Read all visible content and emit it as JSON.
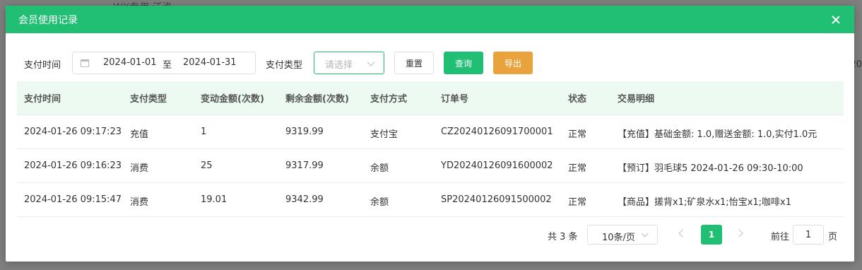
{
  "background": {
    "text": "WX专用  沃洛",
    "edge": "20"
  },
  "modal": {
    "title": "会员使用记录"
  },
  "filters": {
    "pay_time_label": "支付时间",
    "date_start": "2024-01-01",
    "date_sep": "至",
    "date_end": "2024-01-31",
    "pay_type_label": "支付类型",
    "pay_type_placeholder": "请选择",
    "reset_label": "重置",
    "query_label": "查询",
    "export_label": "导出"
  },
  "table": {
    "headers": [
      "支付时间",
      "支付类型",
      "变动金额(次数)",
      "剩余金额(次数)",
      "支付方式",
      "订单号",
      "状态",
      "交易明细"
    ],
    "rows": [
      [
        "2024-01-26 09:17:23",
        "充值",
        "1",
        "9319.99",
        "支付宝",
        "CZ20240126091700001",
        "正常",
        "【充值】基础金额: 1.0,赠送金额: 1.0,实付1.0元"
      ],
      [
        "2024-01-26 09:16:23",
        "消费",
        "25",
        "9317.99",
        "余额",
        "YD20240126091600002",
        "正常",
        "【预订】羽毛球5 2024-01-26 09:30-10:00"
      ],
      [
        "2024-01-26 09:15:47",
        "消费",
        "19.01",
        "9342.99",
        "余额",
        "SP20240126091500002",
        "正常",
        "【商品】搓背x1;矿泉水x1;怡宝x1;咖啡x1"
      ]
    ]
  },
  "pager": {
    "total": "共 3 条",
    "page_size": "10条/页",
    "current_page": "1",
    "goto_label": "前往",
    "goto_value": "1",
    "goto_suffix": "页"
  },
  "colors": {
    "primary": "#20bf73",
    "export": "#e8a33c",
    "header_bg": "#ecfaf2"
  }
}
